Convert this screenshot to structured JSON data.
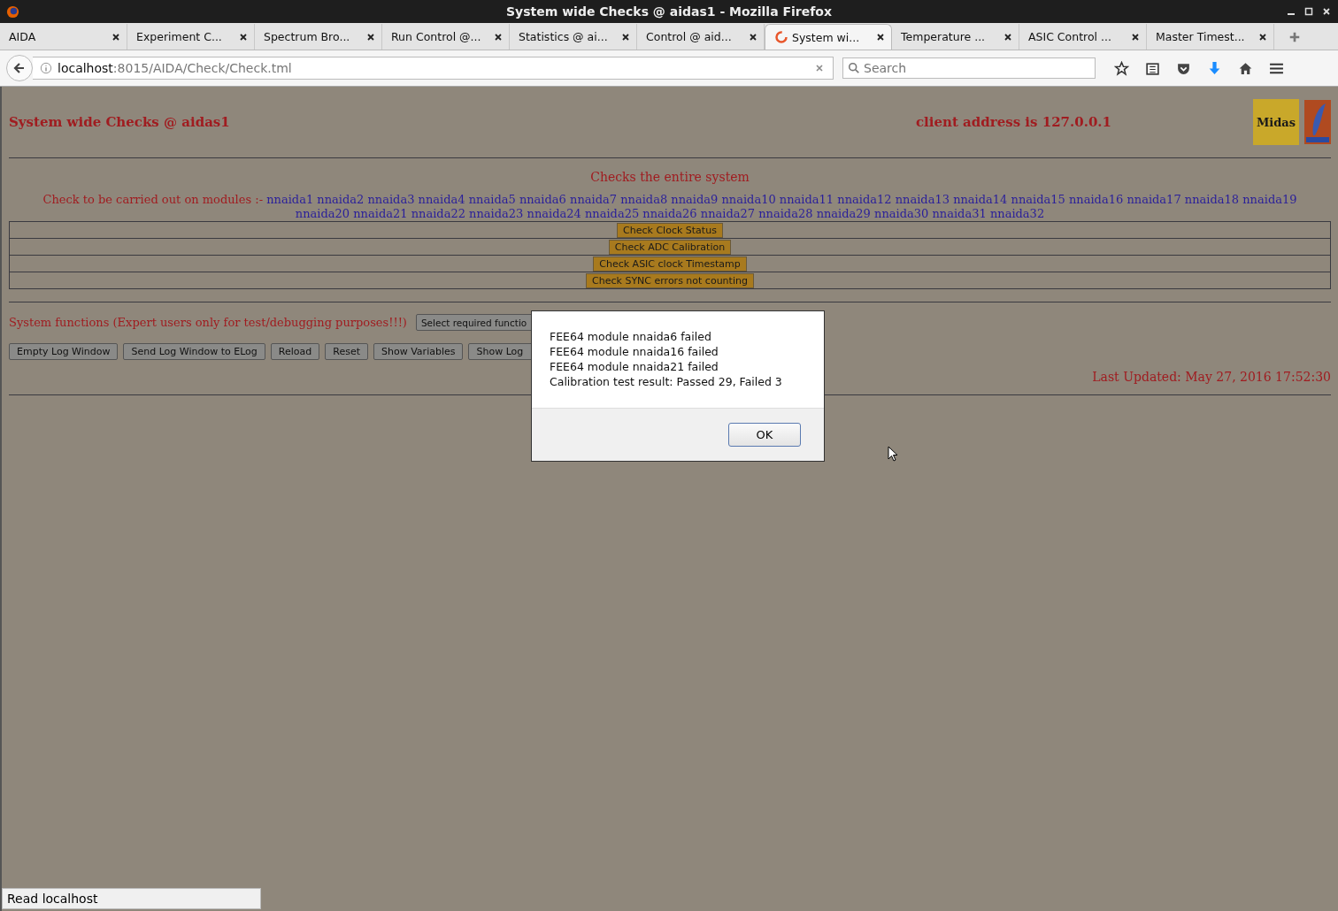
{
  "window": {
    "title": "System wide Checks @ aidas1 - Mozilla Firefox"
  },
  "tabs": [
    {
      "label": "AIDA",
      "selected": false,
      "loading": false
    },
    {
      "label": "Experiment C...",
      "selected": false,
      "loading": false
    },
    {
      "label": "Spectrum Bro...",
      "selected": false,
      "loading": false
    },
    {
      "label": "Run Control @...",
      "selected": false,
      "loading": false
    },
    {
      "label": "Statistics @ ai...",
      "selected": false,
      "loading": false
    },
    {
      "label": "Control @ aid...",
      "selected": false,
      "loading": false
    },
    {
      "label": "System wi...",
      "selected": true,
      "loading": true
    },
    {
      "label": "Temperature ...",
      "selected": false,
      "loading": false
    },
    {
      "label": "ASIC Control ...",
      "selected": false,
      "loading": false
    },
    {
      "label": "Master Timest...",
      "selected": false,
      "loading": false
    }
  ],
  "address_bar": {
    "host": "localhost",
    "path": ":8015/AIDA/Check/Check.tml"
  },
  "search": {
    "placeholder": "Search"
  },
  "page": {
    "title": "System wide Checks @ aidas1",
    "client_address": "client address is 127.0.0.1",
    "logo_text": "Midas",
    "subtitle": "Checks the entire system",
    "modules_label": "Check to be carried out on modules :-",
    "modules": [
      "nnaida1",
      "nnaida2",
      "nnaida3",
      "nnaida4",
      "nnaida5",
      "nnaida6",
      "nnaida7",
      "nnaida8",
      "nnaida9",
      "nnaida10",
      "nnaida11",
      "nnaida12",
      "nnaida13",
      "nnaida14",
      "nnaida15",
      "nnaida16",
      "nnaida17",
      "nnaida18",
      "nnaida19",
      "nnaida20",
      "nnaida21",
      "nnaida22",
      "nnaida23",
      "nnaida24",
      "nnaida25",
      "nnaida26",
      "nnaida27",
      "nnaida28",
      "nnaida29",
      "nnaida30",
      "nnaida31",
      "nnaida32"
    ],
    "check_buttons": [
      "Check Clock Status",
      "Check ADC Calibration",
      "Check ASIC clock Timestamp",
      "Check SYNC errors not counting"
    ],
    "system_functions_label": "System functions (Expert users only for test/debugging purposes!!!)",
    "function_select": "Select required functio",
    "buttons": [
      "Empty Log Window",
      "Send Log Window to ELog",
      "Reload",
      "Reset",
      "Show Variables",
      "Show Log"
    ],
    "last_updated": "Last Updated: May 27, 2016 17:52:30"
  },
  "dialog": {
    "lines": [
      "FEE64 module nnaida6 failed",
      "FEE64 module nnaida16 failed",
      "FEE64 module nnaida21 failed",
      "Calibration test result: Passed 29, Failed 3"
    ],
    "button": "OK"
  },
  "status_bar": "Read localhost"
}
